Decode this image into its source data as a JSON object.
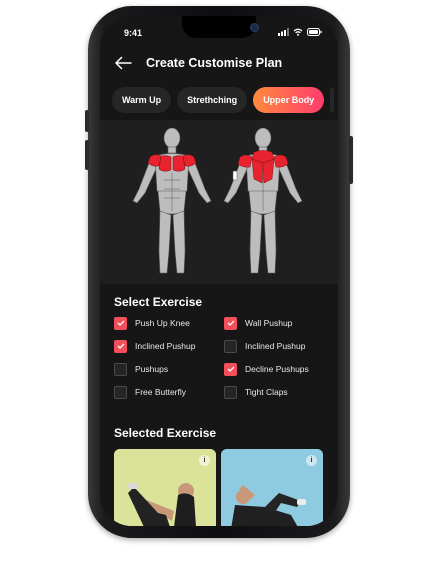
{
  "status": {
    "time": "9:41"
  },
  "header": {
    "title": "Create Customise Plan"
  },
  "categories": [
    {
      "label": "Warm Up",
      "active": false
    },
    {
      "label": "Strethching",
      "active": false
    },
    {
      "label": "Upper Body",
      "active": true
    }
  ],
  "select_section": {
    "title": "Select Exercise",
    "exercises": [
      {
        "label": "Push Up Knee",
        "checked": true
      },
      {
        "label": "Wall Pushup",
        "checked": true
      },
      {
        "label": "Inclined Pushup",
        "checked": true
      },
      {
        "label": "Inclined Pushup",
        "checked": false
      },
      {
        "label": "Pushups",
        "checked": false
      },
      {
        "label": "Decline Pushups",
        "checked": true
      },
      {
        "label": "Free Butterfly",
        "checked": false
      },
      {
        "label": "Tight Claps",
        "checked": false
      }
    ]
  },
  "selected_section": {
    "title": "Selected Exercise",
    "info_glyph": "i"
  },
  "colors": {
    "accent_start": "#ff8a3d",
    "accent_end": "#ff3d6e",
    "checkbox_checked": "#f24e5b",
    "muscle_highlight": "#e8232f",
    "muscle_base": "#bdbdbd",
    "screen_bg": "#161616"
  },
  "icons": [
    "back-arrow-icon",
    "signal-icon",
    "wifi-icon",
    "battery-icon",
    "check-icon",
    "info-icon"
  ]
}
